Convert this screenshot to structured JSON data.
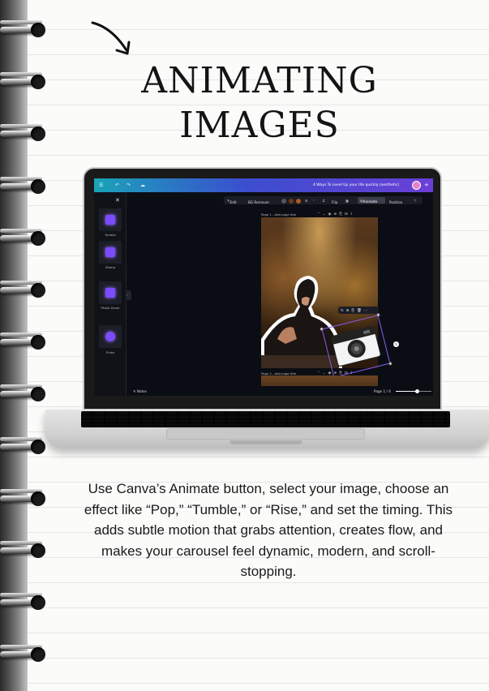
{
  "page": {
    "title_line1": "ANIMATING",
    "title_line2": "IMAGES",
    "body": "Use Canva’s Animate button, select your image, choose an effect like “Pop,” “Tumble,” or “Rise,” and set the timing. This adds subtle motion that grabs attention, creates flow, and makes your carousel feel dynamic, modern, and scroll-stopping."
  },
  "canva": {
    "doc_title": "4 Ways To Level Up your life quickly (aesthetic)",
    "side_panel": {
      "effects": [
        {
          "label": "Tumble",
          "icon": "tumble-icon"
        },
        {
          "label": "Stomp",
          "icon": "stomp-icon"
        },
        {
          "label": "Photo Zoom",
          "icon": "photo-zoom-icon"
        },
        {
          "label": "Pulse",
          "icon": "pulse-icon"
        }
      ]
    },
    "toolbar": {
      "edit": "Edit",
      "bg_remover": "BG Remover",
      "flip": "Flip",
      "animate": "Animate",
      "position": "Position"
    },
    "pages": [
      {
        "label": "Page 1 - Add page title"
      },
      {
        "label": "Page 2 - Add page title"
      }
    ],
    "bottom": {
      "notes": "Notes",
      "page_indicator": "Page 1 / 4",
      "zoom_fraction": 0.6
    },
    "colors": {
      "topbar_start": "#1aa3b8",
      "topbar_end": "#6b3fd6",
      "selection": "#8b5cf6",
      "effect_gem": "#7a4cff"
    }
  }
}
